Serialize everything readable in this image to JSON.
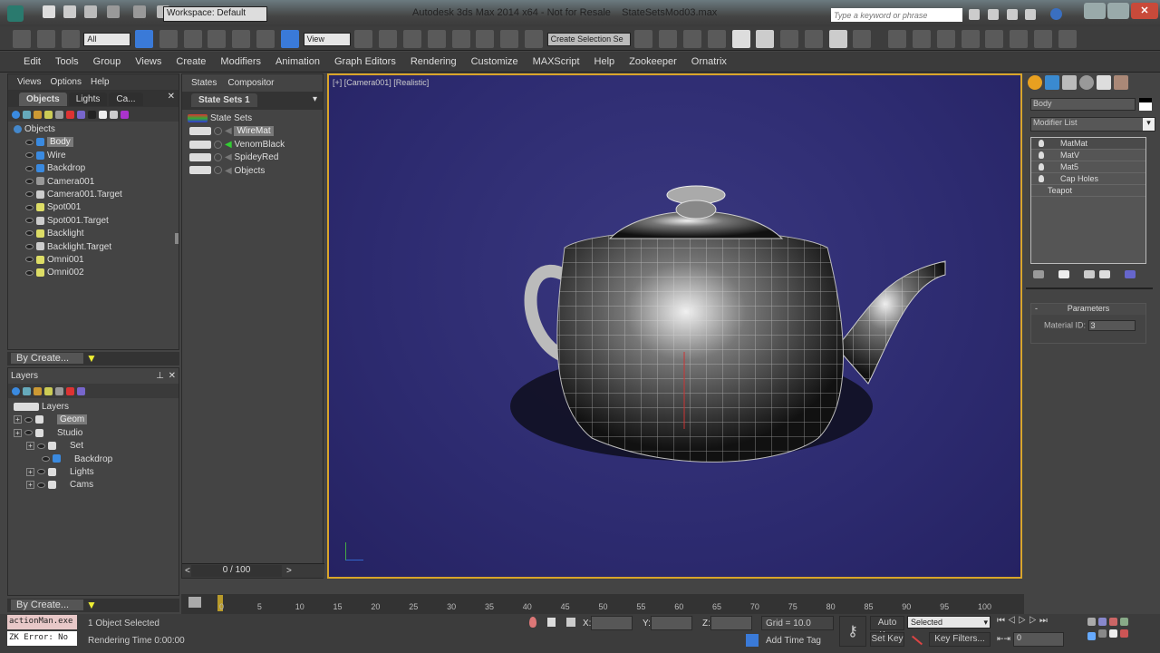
{
  "title_bar": {
    "workspace": "Workspace: Default",
    "app_title": "Autodesk 3ds Max  2014 x64   - Not for Resale",
    "file_name": "StateSetsMod03.max",
    "search_placeholder": "Type a keyword or phrase"
  },
  "main_toolbar": {
    "selection_filter": "All",
    "reference_coord": "View",
    "named_selection": "Create Selection Se"
  },
  "menu": [
    "Edit",
    "Tools",
    "Group",
    "Views",
    "Create",
    "Modifiers",
    "Animation",
    "Graph Editors",
    "Rendering",
    "Customize",
    "MAXScript",
    "Help",
    "Zookeeper",
    "Ornatrix"
  ],
  "scene_explorer": {
    "menu": [
      "Views",
      "Options",
      "Help"
    ],
    "tabs": [
      "Objects",
      "Lights",
      "Ca..."
    ],
    "root": "Objects",
    "items": [
      {
        "name": "Body",
        "type": "box",
        "selected": true
      },
      {
        "name": "Wire",
        "type": "sphere"
      },
      {
        "name": "Backdrop",
        "type": "box"
      },
      {
        "name": "Camera001",
        "type": "camera"
      },
      {
        "name": "Camera001.Target",
        "type": "target"
      },
      {
        "name": "Spot001",
        "type": "light"
      },
      {
        "name": "Spot001.Target",
        "type": "target"
      },
      {
        "name": "Backlight",
        "type": "light"
      },
      {
        "name": "Backlight.Target",
        "type": "target"
      },
      {
        "name": "Omni001",
        "type": "light"
      },
      {
        "name": "Omni002",
        "type": "light"
      }
    ],
    "by_create": "By Create..."
  },
  "layers": {
    "title": "Layers",
    "root": "Layers",
    "items": [
      {
        "name": "Geom",
        "indent": 0,
        "selected": true
      },
      {
        "name": "Studio",
        "indent": 0
      },
      {
        "name": "Set",
        "indent": 1
      },
      {
        "name": "Backdrop",
        "indent": 2
      },
      {
        "name": "Lights",
        "indent": 1
      },
      {
        "name": "Cams",
        "indent": 1
      }
    ],
    "by_create": "By Create..."
  },
  "state_sets": {
    "menu": [
      "States",
      "Compositor"
    ],
    "tab": "State Sets 1",
    "root": "State Sets",
    "items": [
      {
        "name": "WireMat",
        "selected": true
      },
      {
        "name": "VenomBlack",
        "active": true
      },
      {
        "name": "SpideyRed"
      },
      {
        "name": "Objects"
      }
    ],
    "frame": "0 / 100",
    "prev": "<",
    "next": ">"
  },
  "viewport": {
    "label": "[+] [Camera001] [Realistic]",
    "bg": "#2d2b70"
  },
  "command_panel": {
    "object_name": "Body",
    "modifier_list": "Modifier List",
    "stack": [
      "MatMat",
      "MatV",
      "Mat5",
      "Cap Holes",
      "Teapot"
    ],
    "rollout": "Parameters",
    "material_id_label": "Material ID:",
    "material_id": "3"
  },
  "timeline": {
    "ticks": [
      "0",
      "5",
      "10",
      "15",
      "20",
      "25",
      "30",
      "35",
      "40",
      "45",
      "50",
      "55",
      "60",
      "65",
      "70",
      "75",
      "80",
      "85",
      "90",
      "95",
      "100"
    ],
    "current": 0
  },
  "status": {
    "listener1": "actionMan.exe",
    "listener2": "ZK Error: No",
    "selected": "1 Object Selected",
    "render_time": "Rendering Time  0:00:00",
    "x": "X:",
    "y": "Y:",
    "z": "Z:",
    "grid": "Grid = 10.0",
    "add_time_tag": "Add Time Tag",
    "auto_key": "Auto Key",
    "set_key": "Set Key",
    "selected_dropdown": "Selected",
    "key_filters": "Key Filters...",
    "frame_field": "0"
  }
}
